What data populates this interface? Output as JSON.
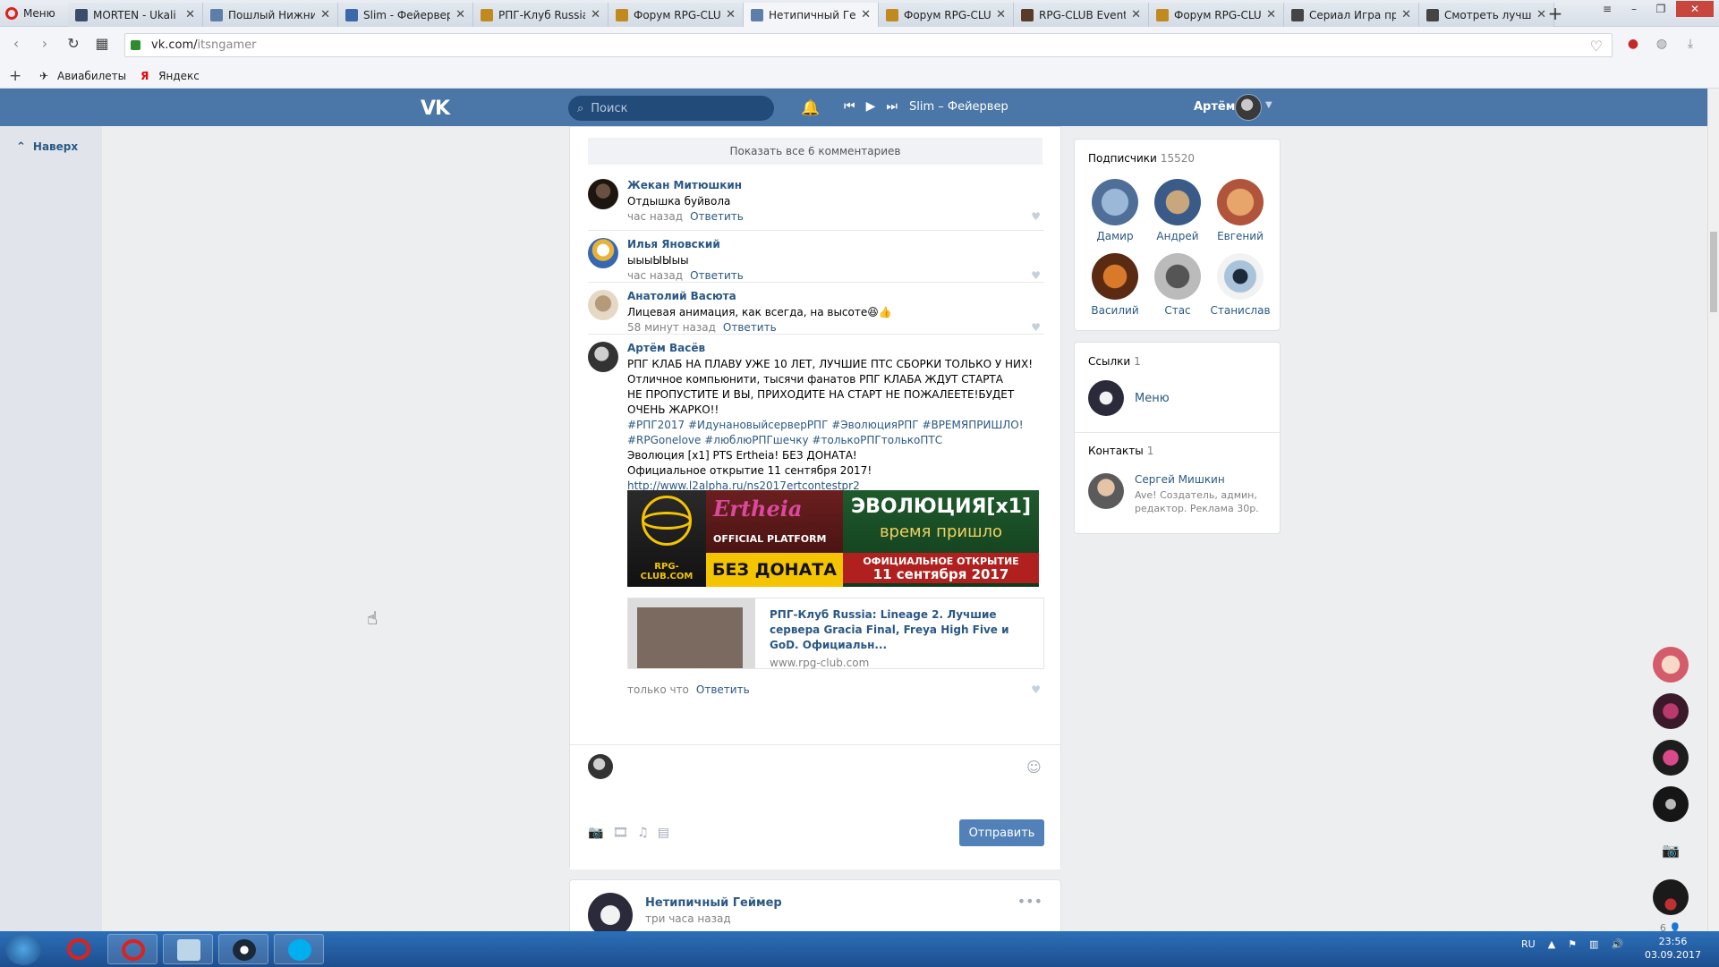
{
  "browser": {
    "menu_label": "Меню",
    "tabs": [
      {
        "title": "MORTEN - Ukali",
        "active": false
      },
      {
        "title": "Пошлый Нижний",
        "active": false
      },
      {
        "title": "Slim - Фейервер",
        "active": false
      },
      {
        "title": "РПГ-Клуб Russia",
        "active": false
      },
      {
        "title": "Форум RPG-CLUB",
        "active": false
      },
      {
        "title": "Нетипичный Гей",
        "active": true
      },
      {
        "title": "Форум RPG-CLUB",
        "active": false
      },
      {
        "title": "RPG-CLUB Events",
        "active": false
      },
      {
        "title": "Форум RPG-CLUB",
        "active": false
      },
      {
        "title": "Сериал Игра пре",
        "active": false
      },
      {
        "title": "Смотреть лучши",
        "active": false
      }
    ],
    "url_host": "vk.com/",
    "url_path": "itsngamer",
    "bookmarks": [
      "Авиабилеты",
      "Яндекс"
    ]
  },
  "header": {
    "logo": "VK",
    "search_placeholder": "Поиск",
    "track": "Slim – Фейервер",
    "user_name": "Артём"
  },
  "left": {
    "to_top": "Наверх"
  },
  "wall": {
    "show_all": "Показать все 6 комментариев",
    "reply_label": "Ответить",
    "comments": [
      {
        "author": "Жекан Митюшкин",
        "text": "Отдышка буйвола",
        "time": "час назад"
      },
      {
        "author": "Илья Яновский",
        "text": "ыыыЫЫыы",
        "time": "час назад"
      },
      {
        "author": "Анатолий Васюта",
        "text": "Лицевая анимация, как всегда, на высоте😆👍",
        "time": "58 минут назад"
      },
      {
        "author": "Артём Васёв",
        "lines": [
          "РПГ КЛАБ НА ПЛАВУ УЖЕ 10 ЛЕТ, ЛУЧШИЕ ПТС СБОРКИ ТОЛЬКО У НИХ!",
          "Отличное компьюнити, тысячи фанатов РПГ КЛАБА ЖДУТ СТАРТА",
          "НЕ ПРОПУСТИТЕ И ВЫ, ПРИХОДИТЕ НА СТАРТ НЕ ПОЖАЛЕЕТЕ!БУДЕТ",
          "ОЧЕНЬ ЖАРКО!!"
        ],
        "tags_1": "#РПГ2017 #ИдунановыйсерверРПГ #ЭволюцияРПГ #ВРЕМЯПРИШЛО!",
        "tags_2": "#RPGonelove #люблюРПГшечку #толькоРПГтолькоПТС",
        "line_evo": "Эволюция [x1] PTS Ertheia! БЕЗ ДОНАТА!",
        "line_open": "Официальное открытие 11 сентября 2017!",
        "link": "http://www.l2alpha.ru/ns2017ertcontestpr2",
        "time": "только что"
      }
    ],
    "banner": {
      "site": "RPG-CLUB.COM",
      "game": "Ertheia",
      "platform": "OFFICIAL PLATFORM",
      "no_donate": "БЕЗ ДОНАТА",
      "evo": "ЭВОЛЮЦИЯ[x1]",
      "time": "время пришло",
      "opening": "ОФИЦИАЛЬНОЕ ОТКРЫТИЕ",
      "date": "11 сентября 2017"
    },
    "link_card": {
      "title": "РПГ-Клуб Russia: Lineage 2. Лучшие сервера Gracia Final, Freya High Five и GoD. Официальн...",
      "domain": "www.rpg-club.com"
    },
    "send_label": "Отправить"
  },
  "post2": {
    "author": "Нетипичный Геймер",
    "time": "три часа назад"
  },
  "sidebar": {
    "subscribers": {
      "title": "Подписчики",
      "count": "15520",
      "people": [
        "Дамир",
        "Андрей",
        "Евгений",
        "Василий",
        "Стас",
        "Станислав"
      ]
    },
    "links": {
      "title": "Ссылки",
      "count": "1",
      "item": "Меню"
    },
    "contacts": {
      "title": "Контакты",
      "count": "1",
      "name": "Сергей Мишкин",
      "desc_1": "Ave! Создатель, админ,",
      "desc_2": "редактор. Реклама 30р."
    }
  },
  "chat": {
    "online_count": "6"
  },
  "taskbar": {
    "lang": "RU",
    "time": "23:56",
    "date": "03.09.2017"
  },
  "colors": {
    "vk_blue": "#4a76a8",
    "link": "#2a5885",
    "send_button": "#5181b8"
  }
}
